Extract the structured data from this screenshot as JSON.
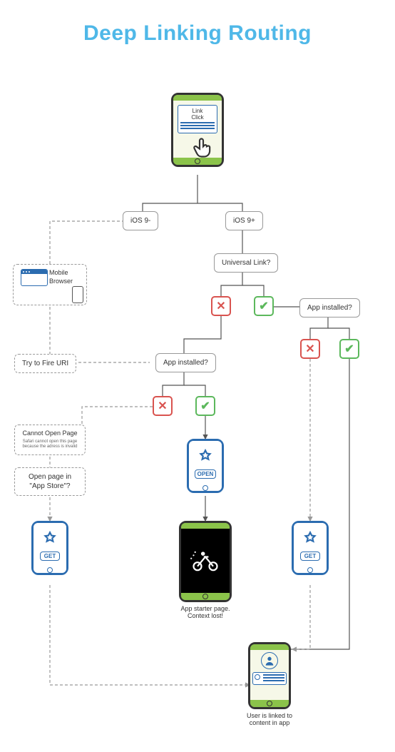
{
  "title": "Deep Linking Routing",
  "nodes": {
    "link_click": "Link\nClick",
    "ios_old": "iOS 9-",
    "ios_new": "iOS 9+",
    "universal_link": "Universal Link?",
    "app_installed_right": "App installed?",
    "app_installed_mid": "App installed?",
    "mobile_browser": "Mobile\nBrowser",
    "fire_uri": "Try to Fire URI",
    "cannot_open_title": "Cannot Open Page",
    "cannot_open_sub": "Safari cannot open this page because the adress is invalid",
    "open_appstore": "Open page in \"App Store\"?",
    "open_label": "OPEN",
    "get_label": "GET",
    "starter_page": "App starter page.\nContext lost!",
    "linked_content": "User is linked to content in app"
  },
  "icons": {
    "tap_hand": "hand-tap-icon",
    "appstore": "appstore-icon",
    "bike": "bike-icon",
    "user": "user-icon"
  }
}
